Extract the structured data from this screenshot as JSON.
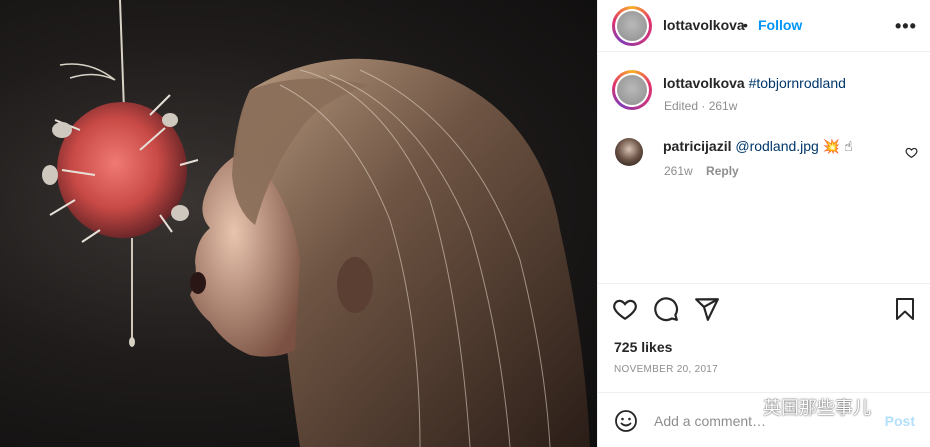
{
  "post": {
    "author": "lottavolkova",
    "follow_label": "Follow",
    "separator": "•",
    "more_label": "•••"
  },
  "caption": {
    "username": "lottavolkova",
    "text": "#tobjornrodland",
    "edited": "Edited",
    "time": "261w"
  },
  "comment": {
    "username": "patricijazil",
    "mention": "@rodland.jpg",
    "emoji": "💥 ☝",
    "time": "261w",
    "reply_label": "Reply"
  },
  "stats": {
    "likes": "725 likes",
    "date": "NOVEMBER 20, 2017"
  },
  "add_comment": {
    "placeholder": "Add a comment…",
    "post_label": "Post"
  },
  "watermark": {
    "text": "英国那些事儿"
  },
  "colors": {
    "link_blue": "#0095f6",
    "hashtag": "#00376b",
    "muted": "#8e8e8e"
  }
}
